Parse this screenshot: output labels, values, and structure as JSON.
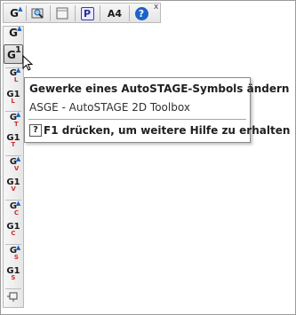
{
  "tooltip": {
    "title": "Gewerke eines AutoSTAGE-Symbols ändern",
    "subtitle": "ASGE - AutoSTAGE 2D Toolbox",
    "help_key": "?",
    "help_text": "F1 drücken, um weitere Hilfe zu erhalten"
  },
  "top_toolbar": {
    "a4_label": "A4",
    "p_label": "P",
    "help_label": "?",
    "close_label": "x"
  },
  "left_toolbar": {
    "glyph_g": "G",
    "glyph_1": "1",
    "sub_l": "L",
    "sub_t": "T",
    "sub_v": "V",
    "sub_c": "C",
    "sub_s": "S"
  }
}
